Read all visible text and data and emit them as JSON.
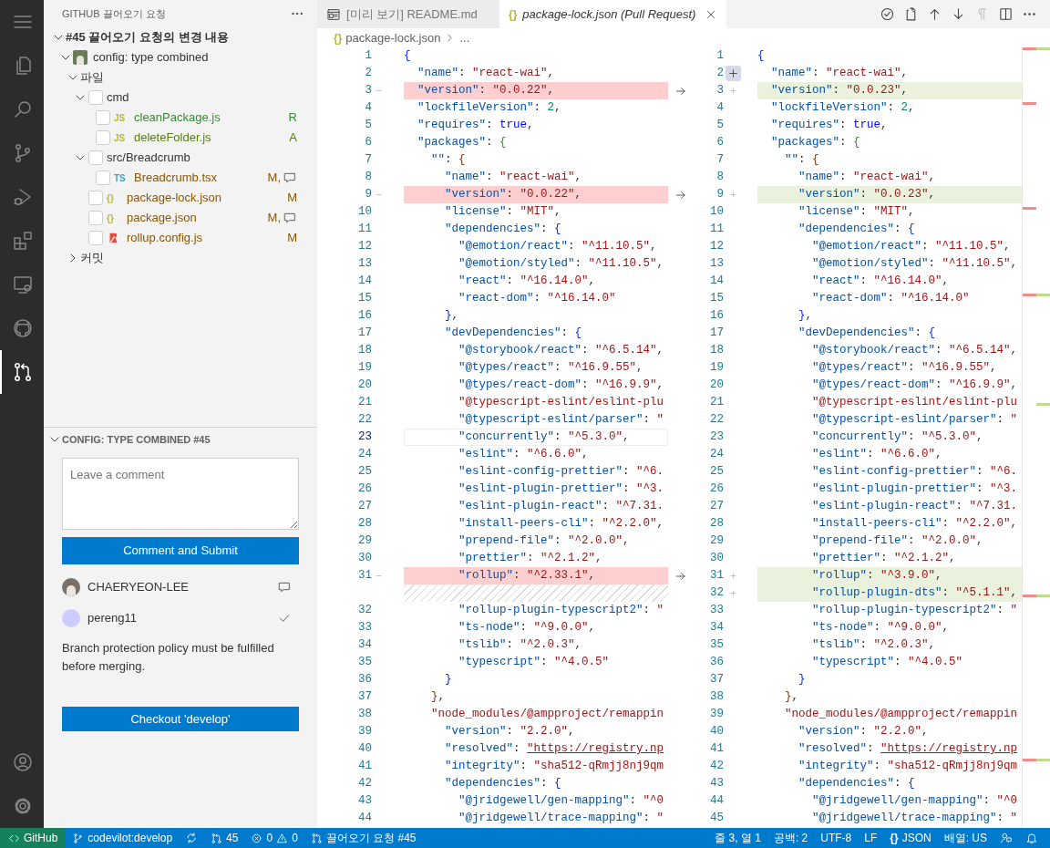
{
  "activity_bar": [
    {
      "kind": "menu",
      "selected": false
    },
    {
      "kind": "explorer",
      "selected": false
    },
    {
      "kind": "search",
      "selected": false
    },
    {
      "kind": "scm",
      "selected": false
    },
    {
      "kind": "debug",
      "selected": false
    },
    {
      "kind": "extensions",
      "selected": false
    },
    {
      "kind": "remote",
      "selected": false
    },
    {
      "kind": "github",
      "selected": false
    },
    {
      "kind": "pullrequests",
      "selected": true
    },
    {
      "kind": "accounts",
      "selected": false
    },
    {
      "kind": "settings",
      "selected": false
    }
  ],
  "sidebar": {
    "title": "GITHUB 끌어오기 요청",
    "tree": [
      {
        "label": "#45 끌어오기 요청의 변경 내용",
        "kind": "pr",
        "expanded": true,
        "children": [
          {
            "label": "config: type combined",
            "kind": "commit",
            "expanded": true,
            "children": [
              {
                "label": "파일",
                "kind": "group",
                "expanded": true,
                "children": [
                  {
                    "label": "cmd",
                    "kind": "folder",
                    "expanded": true,
                    "checked": false,
                    "children": [
                      {
                        "label": "cleanPackage.js",
                        "kind": "js",
                        "icon": "JS",
                        "checked": false,
                        "status": "R",
                        "comments": false,
                        "color": "#388a34"
                      },
                      {
                        "label": "deleteFolder.js",
                        "kind": "js",
                        "icon": "JS",
                        "checked": false,
                        "status": "A",
                        "comments": false,
                        "color": "#587c0c"
                      }
                    ]
                  },
                  {
                    "label": "src/Breadcrumb",
                    "kind": "folder",
                    "expanded": true,
                    "checked": false,
                    "children": [
                      {
                        "label": "Breadcrumb.tsx",
                        "kind": "ts",
                        "icon": "TS",
                        "checked": false,
                        "status": "M,",
                        "comments": true,
                        "color": "#895503"
                      }
                    ]
                  },
                  {
                    "label": "package-lock.json",
                    "kind": "json",
                    "icon": "{}",
                    "checked": false,
                    "status": "M",
                    "comments": false,
                    "color": "#895503"
                  },
                  {
                    "label": "package.json",
                    "kind": "json",
                    "icon": "{}",
                    "checked": false,
                    "status": "M,",
                    "comments": true,
                    "color": "#895503"
                  },
                  {
                    "label": "rollup.config.js",
                    "kind": "rollup",
                    "checked": false,
                    "status": "M",
                    "comments": false,
                    "color": "#895503"
                  }
                ]
              },
              {
                "label": "커밋",
                "kind": "group",
                "expanded": false
              }
            ]
          }
        ]
      }
    ],
    "section": {
      "title": "CONFIG: TYPE COMBINED #45",
      "expanded": true,
      "comment_placeholder": "Leave a comment",
      "submit_button": "Comment and Submit",
      "reviewers": [
        {
          "name": "CHAERYEON-LEE",
          "kind": "commented"
        },
        {
          "name": "pereng11",
          "color": "#ccccff",
          "kind": "approved"
        }
      ],
      "message": "Branch protection policy must be fulfilled before merging.",
      "checkout_button": "Checkout 'develop'"
    }
  },
  "tabs": [
    {
      "label": "[미리 보기] README.md",
      "kind": "preview",
      "preview": false,
      "selected": false
    },
    {
      "label": "package-lock.json (Pull Request)",
      "kind": "json",
      "icon": "{}",
      "preview": true,
      "selected": true
    }
  ],
  "editor_actions": [
    {
      "kind": "check",
      "disabled": false
    },
    {
      "kind": "open",
      "disabled": false
    },
    {
      "kind": "up",
      "disabled": false
    },
    {
      "kind": "down",
      "disabled": false
    },
    {
      "kind": "whitespace",
      "disabled": true
    },
    {
      "kind": "split",
      "disabled": false
    },
    {
      "kind": "more",
      "disabled": false
    }
  ],
  "breadcrumb": {
    "icon": "{}",
    "items": [
      "package-lock.json",
      "..."
    ]
  },
  "diff_rows": [
    {
      "left": {
        "number": "1",
        "text": "{",
        "kind": "same"
      },
      "right": {
        "number": "1",
        "text": "{",
        "kind": "same"
      }
    },
    {
      "left": {
        "number": "2",
        "text": "  \"name\": \"react-wai\",",
        "kind": "same"
      },
      "right": {
        "number": "2",
        "text": "  \"name\": \"react-wai\",",
        "kind": "same",
        "add_comment": true
      }
    },
    {
      "left": {
        "number": "3",
        "text": "  \"version\": \"0.0.22\",",
        "kind": "removed"
      },
      "right": {
        "number": "3",
        "text": "  \"version\": \"0.0.23\",",
        "kind": "added"
      }
    },
    {
      "left": {
        "number": "4",
        "text": "  \"lockfileVersion\": 2,",
        "kind": "same"
      },
      "right": {
        "number": "4",
        "text": "  \"lockfileVersion\": 2,",
        "kind": "same"
      }
    },
    {
      "left": {
        "number": "5",
        "text": "  \"requires\": true,",
        "kind": "same"
      },
      "right": {
        "number": "5",
        "text": "  \"requires\": true,",
        "kind": "same"
      }
    },
    {
      "left": {
        "number": "6",
        "text": "  \"packages\": {",
        "kind": "same"
      },
      "right": {
        "number": "6",
        "text": "  \"packages\": {",
        "kind": "same"
      }
    },
    {
      "left": {
        "number": "7",
        "text": "    \"\": {",
        "kind": "same"
      },
      "right": {
        "number": "7",
        "text": "    \"\": {",
        "kind": "same"
      }
    },
    {
      "left": {
        "number": "8",
        "text": "      \"name\": \"react-wai\",",
        "kind": "same"
      },
      "right": {
        "number": "8",
        "text": "      \"name\": \"react-wai\",",
        "kind": "same"
      }
    },
    {
      "left": {
        "number": "9",
        "text": "      \"version\": \"0.0.22\",",
        "kind": "removed"
      },
      "right": {
        "number": "9",
        "text": "      \"version\": \"0.0.23\",",
        "kind": "added"
      }
    },
    {
      "left": {
        "number": "10",
        "text": "      \"license\": \"MIT\",",
        "kind": "same"
      },
      "right": {
        "number": "10",
        "text": "      \"license\": \"MIT\",",
        "kind": "same"
      }
    },
    {
      "left": {
        "number": "11",
        "text": "      \"dependencies\": {",
        "kind": "same"
      },
      "right": {
        "number": "11",
        "text": "      \"dependencies\": {",
        "kind": "same"
      }
    },
    {
      "left": {
        "number": "12",
        "text": "        \"@emotion/react\": \"^11.10.5\",",
        "kind": "same"
      },
      "right": {
        "number": "12",
        "text": "        \"@emotion/react\": \"^11.10.5\",",
        "kind": "same"
      }
    },
    {
      "left": {
        "number": "13",
        "text": "        \"@emotion/styled\": \"^11.10.5\",",
        "kind": "same"
      },
      "right": {
        "number": "13",
        "text": "        \"@emotion/styled\": \"^11.10.5\",",
        "kind": "same"
      }
    },
    {
      "left": {
        "number": "14",
        "text": "        \"react\": \"^16.14.0\",",
        "kind": "same"
      },
      "right": {
        "number": "14",
        "text": "        \"react\": \"^16.14.0\",",
        "kind": "same"
      }
    },
    {
      "left": {
        "number": "15",
        "text": "        \"react-dom\": \"^16.14.0\"",
        "kind": "same"
      },
      "right": {
        "number": "15",
        "text": "        \"react-dom\": \"^16.14.0\"",
        "kind": "same"
      }
    },
    {
      "left": {
        "number": "16",
        "text": "      },",
        "kind": "same"
      },
      "right": {
        "number": "16",
        "text": "      },",
        "kind": "same"
      }
    },
    {
      "left": {
        "number": "17",
        "text": "      \"devDependencies\": {",
        "kind": "same"
      },
      "right": {
        "number": "17",
        "text": "      \"devDependencies\": {",
        "kind": "same"
      }
    },
    {
      "left": {
        "number": "18",
        "text": "        \"@storybook/react\": \"^6.5.14\",",
        "kind": "same"
      },
      "right": {
        "number": "18",
        "text": "        \"@storybook/react\": \"^6.5.14\",",
        "kind": "same"
      }
    },
    {
      "left": {
        "number": "19",
        "text": "        \"@types/react\": \"^16.9.55\",",
        "kind": "same"
      },
      "right": {
        "number": "19",
        "text": "        \"@types/react\": \"^16.9.55\",",
        "kind": "same"
      }
    },
    {
      "left": {
        "number": "20",
        "text": "        \"@types/react-dom\": \"^16.9.9\",",
        "kind": "same"
      },
      "right": {
        "number": "20",
        "text": "        \"@types/react-dom\": \"^16.9.9\",",
        "kind": "same"
      }
    },
    {
      "left": {
        "number": "21",
        "text": "        \"@typescript-eslint/eslint-plu",
        "kind": "same"
      },
      "right": {
        "number": "21",
        "text": "        \"@typescript-eslint/eslint-plu",
        "kind": "same"
      }
    },
    {
      "left": {
        "number": "22",
        "text": "        \"@typescript-eslint/parser\": \"",
        "kind": "same"
      },
      "right": {
        "number": "22",
        "text": "        \"@typescript-eslint/parser\": \"",
        "kind": "same"
      }
    },
    {
      "left": {
        "number": "23",
        "text": "        \"concurrently\": \"^5.3.0\",",
        "kind": "same",
        "current": true
      },
      "right": {
        "number": "23",
        "text": "        \"concurrently\": \"^5.3.0\",",
        "kind": "same"
      }
    },
    {
      "left": {
        "number": "24",
        "text": "        \"eslint\": \"^6.6.0\",",
        "kind": "same"
      },
      "right": {
        "number": "24",
        "text": "        \"eslint\": \"^6.6.0\",",
        "kind": "same"
      }
    },
    {
      "left": {
        "number": "25",
        "text": "        \"eslint-config-prettier\": \"^6.",
        "kind": "same"
      },
      "right": {
        "number": "25",
        "text": "        \"eslint-config-prettier\": \"^6.",
        "kind": "same"
      }
    },
    {
      "left": {
        "number": "26",
        "text": "        \"eslint-plugin-prettier\": \"^3.",
        "kind": "same"
      },
      "right": {
        "number": "26",
        "text": "        \"eslint-plugin-prettier\": \"^3.",
        "kind": "same"
      }
    },
    {
      "left": {
        "number": "27",
        "text": "        \"eslint-plugin-react\": \"^7.31.",
        "kind": "same"
      },
      "right": {
        "number": "27",
        "text": "        \"eslint-plugin-react\": \"^7.31.",
        "kind": "same"
      }
    },
    {
      "left": {
        "number": "28",
        "text": "        \"install-peers-cli\": \"^2.2.0\",",
        "kind": "same"
      },
      "right": {
        "number": "28",
        "text": "        \"install-peers-cli\": \"^2.2.0\",",
        "kind": "same"
      }
    },
    {
      "left": {
        "number": "29",
        "text": "        \"prepend-file\": \"^2.0.0\",",
        "kind": "same"
      },
      "right": {
        "number": "29",
        "text": "        \"prepend-file\": \"^2.0.0\",",
        "kind": "same"
      }
    },
    {
      "left": {
        "number": "30",
        "text": "        \"prettier\": \"^2.1.2\",",
        "kind": "same"
      },
      "right": {
        "number": "30",
        "text": "        \"prettier\": \"^2.1.2\",",
        "kind": "same"
      }
    },
    {
      "left": {
        "number": "31",
        "text": "        \"rollup\": \"^2.33.1\",",
        "kind": "removed"
      },
      "right": {
        "number": "31",
        "text": "        \"rollup\": \"^3.9.0\",",
        "kind": "added"
      }
    },
    {
      "left": {
        "kind": "filler"
      },
      "right": {
        "number": "32",
        "text": "        \"rollup-plugin-dts\": \"^5.1.1\",",
        "kind": "added"
      }
    },
    {
      "left": {
        "number": "32",
        "text": "        \"rollup-plugin-typescript2\": \"",
        "kind": "same"
      },
      "right": {
        "number": "33",
        "text": "        \"rollup-plugin-typescript2\": \"",
        "kind": "same"
      }
    },
    {
      "left": {
        "number": "33",
        "text": "        \"ts-node\": \"^9.0.0\",",
        "kind": "same"
      },
      "right": {
        "number": "34",
        "text": "        \"ts-node\": \"^9.0.0\",",
        "kind": "same"
      }
    },
    {
      "left": {
        "number": "34",
        "text": "        \"tslib\": \"^2.0.3\",",
        "kind": "same"
      },
      "right": {
        "number": "35",
        "text": "        \"tslib\": \"^2.0.3\",",
        "kind": "same"
      }
    },
    {
      "left": {
        "number": "35",
        "text": "        \"typescript\": \"^4.0.5\"",
        "kind": "same"
      },
      "right": {
        "number": "36",
        "text": "        \"typescript\": \"^4.0.5\"",
        "kind": "same"
      }
    },
    {
      "left": {
        "number": "36",
        "text": "      }",
        "kind": "same"
      },
      "right": {
        "number": "37",
        "text": "      }",
        "kind": "same"
      }
    },
    {
      "left": {
        "number": "37",
        "text": "    },",
        "kind": "same"
      },
      "right": {
        "number": "38",
        "text": "    },",
        "kind": "same"
      }
    },
    {
      "left": {
        "number": "38",
        "text": "    \"node_modules/@ampproject/remappin",
        "kind": "same"
      },
      "right": {
        "number": "39",
        "text": "    \"node_modules/@ampproject/remappin",
        "kind": "same"
      }
    },
    {
      "left": {
        "number": "39",
        "text": "      \"version\": \"2.2.0\",",
        "kind": "same"
      },
      "right": {
        "number": "40",
        "text": "      \"version\": \"2.2.0\",",
        "kind": "same"
      }
    },
    {
      "left": {
        "number": "40",
        "text": "      \"resolved\": \"https://registry.np",
        "kind": "same"
      },
      "right": {
        "number": "41",
        "text": "      \"resolved\": \"https://registry.np",
        "kind": "same"
      }
    },
    {
      "left": {
        "number": "41",
        "text": "      \"integrity\": \"sha512-qRmjj8nj9qm",
        "kind": "same"
      },
      "right": {
        "number": "42",
        "text": "      \"integrity\": \"sha512-qRmjj8nj9qm",
        "kind": "same"
      }
    },
    {
      "left": {
        "number": "42",
        "text": "      \"dependencies\": {",
        "kind": "same"
      },
      "right": {
        "number": "43",
        "text": "      \"dependencies\": {",
        "kind": "same"
      }
    },
    {
      "left": {
        "number": "43",
        "text": "        \"@jridgewell/gen-mapping\": \"^0",
        "kind": "same"
      },
      "right": {
        "number": "44",
        "text": "        \"@jridgewell/gen-mapping\": \"^0",
        "kind": "same"
      }
    },
    {
      "left": {
        "number": "44",
        "text": "        \"@jridgewell/trace-mapping\": \"",
        "kind": "same"
      },
      "right": {
        "number": "45",
        "text": "        \"@jridgewell/trace-mapping\": \"",
        "kind": "same"
      }
    }
  ],
  "status_bar": {
    "left": [
      {
        "kind": "remote",
        "text": "GitHub"
      },
      {
        "kind": "branch",
        "text": "codevilot:develop"
      },
      {
        "kind": "sync"
      },
      {
        "kind": "pr",
        "text": "45"
      },
      {
        "kind": "problems",
        "errors": "0",
        "warnings": "0"
      },
      {
        "kind": "prlink",
        "text": "끌어오기 요청 #45"
      }
    ],
    "right": [
      {
        "kind": "position",
        "text": "줄 3, 열 1"
      },
      {
        "kind": "indent",
        "text": "공백: 2"
      },
      {
        "kind": "encoding",
        "text": "UTF-8"
      },
      {
        "kind": "eol",
        "text": "LF"
      },
      {
        "kind": "language",
        "icon": "{}",
        "text": "JSON"
      },
      {
        "kind": "layout",
        "text": "배열: US"
      },
      {
        "kind": "feedback"
      },
      {
        "kind": "bell"
      }
    ]
  }
}
